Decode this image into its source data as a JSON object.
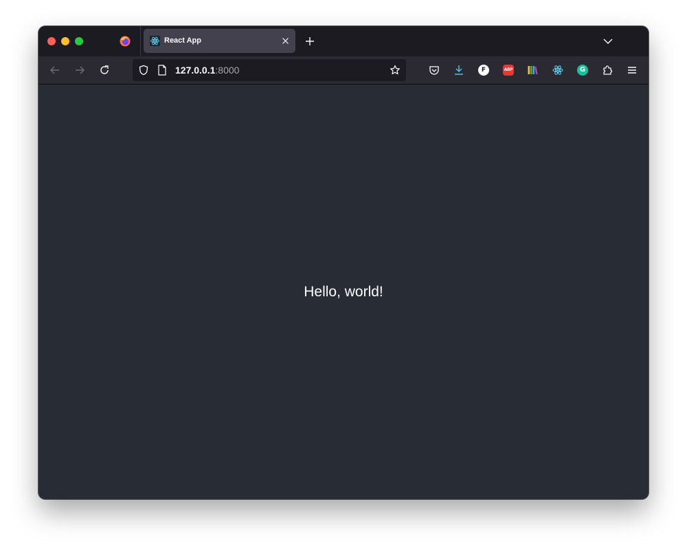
{
  "browser": {
    "tab": {
      "title": "React App",
      "favicon": "react-icon"
    },
    "address_bar": {
      "host": "127.0.0.1",
      "port": ":8000"
    },
    "extensions": {
      "f_badge": "F",
      "abp_badge": "ABP",
      "g_badge": "G"
    },
    "colors": {
      "chrome_bg": "#1c1b22",
      "toolbar_bg": "#2b2a33",
      "active_tab_bg": "#42414d",
      "react_accent": "#61dafb",
      "pocket_accent": "#ef4056",
      "download_accent": "#54ffbd"
    }
  },
  "page": {
    "message": "Hello, world!",
    "background": "#282c34"
  }
}
